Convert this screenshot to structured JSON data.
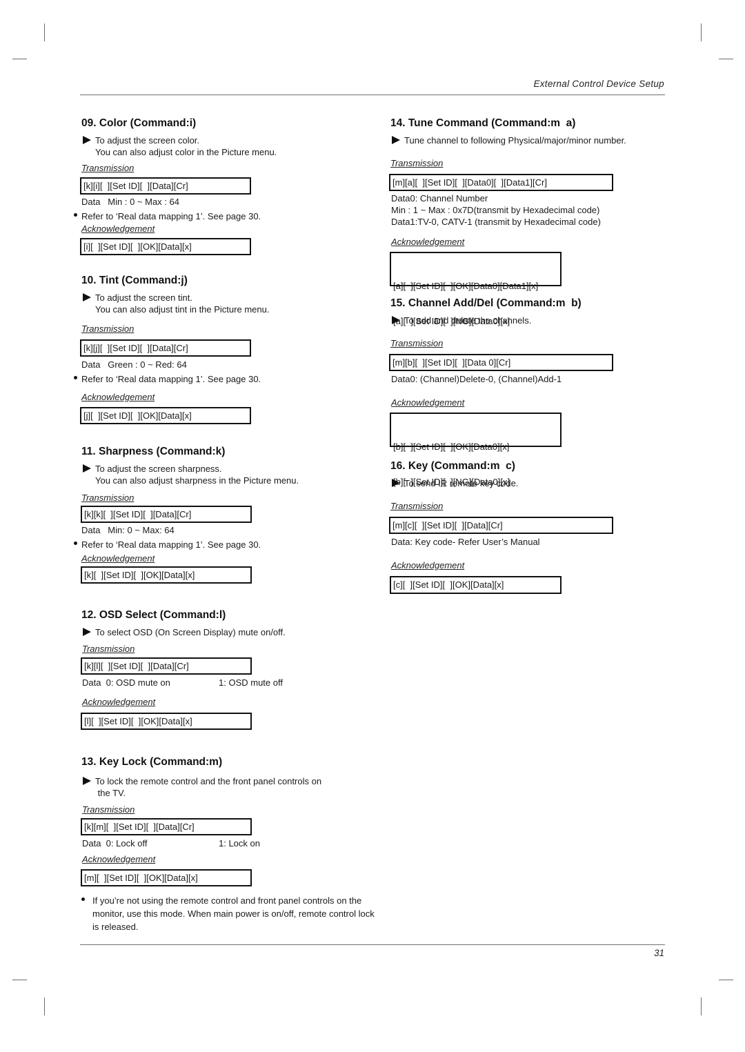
{
  "header": {
    "title": "External Control Device Setup"
  },
  "footer": {
    "page_number": "31"
  },
  "labels": {
    "transmission": "Transmission",
    "acknowledgement": "Acknowledgement"
  },
  "sections": {
    "color": {
      "title": "09. Color (Command:i)",
      "desc": [
        "To adjust the screen color.",
        "You can also adjust color in the Picture menu."
      ],
      "transmission": "[k][i][  ][Set ID][  ][Data][Cr]",
      "data": "Data   Min : 0 ~ Max : 64",
      "note": "Refer to ‘Real data mapping 1’. See page 30.",
      "ack": "[i][  ][Set ID][  ][OK][Data][x]"
    },
    "tint": {
      "title": "10. Tint (Command:j)",
      "desc": [
        "To adjust the screen tint.",
        "You can also adjust tint in the Picture menu."
      ],
      "transmission": "[k][j][  ][Set ID][  ][Data][Cr]",
      "data": "Data   Green : 0 ~ Red: 64",
      "note": "Refer to ‘Real data mapping 1’. See page 30.",
      "ack": "[j][  ][Set ID][  ][OK][Data][x]"
    },
    "sharpness": {
      "title": "11. Sharpness (Command:k)",
      "desc": [
        "To adjust the screen sharpness.",
        "You can also adjust sharpness in the Picture menu."
      ],
      "transmission": "[k][k][  ][Set ID][  ][Data][Cr]",
      "data": "Data   Min: 0 ~ Max: 64",
      "note": "Refer to ‘Real data mapping 1’. See page 30.",
      "ack": "[k][  ][Set ID][  ][OK][Data][x]"
    },
    "osd": {
      "title": "12. OSD Select (Command:l)",
      "desc": [
        "To select OSD (On Screen Display) mute on/off."
      ],
      "transmission": "[k][l][  ][Set ID][  ][Data][Cr]",
      "data_a": "Data  0: OSD mute on",
      "data_b": "1: OSD mute off",
      "ack": "[l][  ][Set ID][  ][OK][Data][x]"
    },
    "keylock": {
      "title": "13. Key Lock (Command:m)",
      "desc": [
        "To lock the remote control and the front panel controls on",
        " the TV."
      ],
      "transmission": "[k][m][  ][Set ID][  ][Data][Cr]",
      "data_a": "Data  0: Lock off",
      "data_b": "1: Lock on",
      "ack": "[m][  ][Set ID][  ][OK][Data][x]",
      "bullet_note": "If you’re not using the remote control and front panel controls on the monitor, use this mode. When main power is on/off, remote control lock is released."
    },
    "tune": {
      "title": "14. Tune Command (Command:m  a)",
      "desc": [
        "Tune channel to following Physical/major/minor number."
      ],
      "transmission": "[m][a][  ][Set ID][  ][Data0][  ][Data1][Cr]",
      "data_lines": [
        "Data0: Channel Number",
        "Min : 1 ~ Max : 0x7D(transmit by Hexadecimal code)",
        "Data1:TV-0, CATV-1 (transmit by Hexadecimal code)"
      ],
      "ack": [
        "[a][  ][Set ID][  ][OK][Data0][Data1][x]",
        "[a][  ][Set ID][  ][NG][Data0][x]"
      ]
    },
    "channel": {
      "title": "15. Channel Add/Del (Command:m  b)",
      "desc": [
        "To add and delete the channels."
      ],
      "transmission": "[m][b][  ][Set ID][  ][Data 0][Cr]",
      "data": "Data0: (Channel)Delete-0, (Channel)Add-1",
      "ack": [
        "[b][  ][Set ID][  ][OK][Data0][x]",
        "[b][  ][Set ID][  ][NG][Data0][x]"
      ]
    },
    "key": {
      "title": "16. Key (Command:m  c)",
      "desc": [
        "To send IR remote key code."
      ],
      "transmission": "[m][c][  ][Set ID][  ][Data][Cr]",
      "data": "Data: Key code- Refer User’s Manual",
      "ack": "[c][  ][Set ID][  ][OK][Data][x]"
    }
  }
}
